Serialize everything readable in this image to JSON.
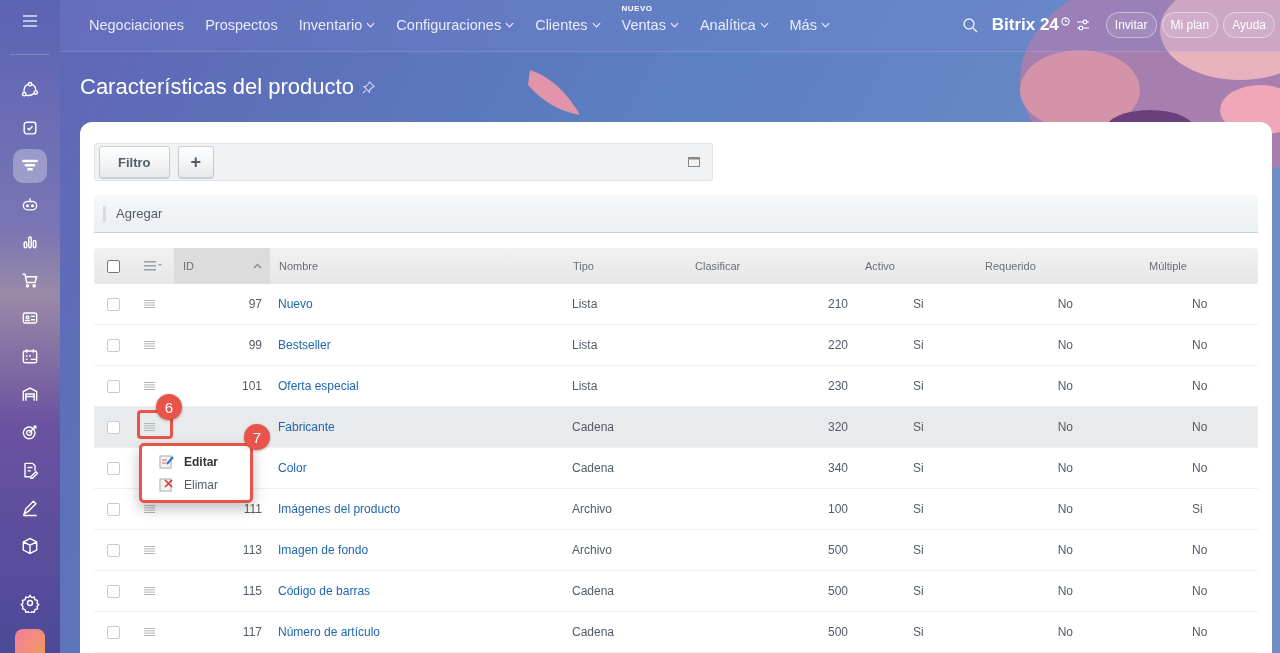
{
  "sidebar": {
    "items": [
      {
        "selected": false
      },
      {
        "selected": false
      },
      {
        "selected": true
      },
      {
        "selected": false
      },
      {
        "selected": false
      },
      {
        "selected": false
      },
      {
        "selected": false
      },
      {
        "selected": false
      },
      {
        "selected": false
      },
      {
        "selected": false
      },
      {
        "selected": false
      },
      {
        "selected": false
      },
      {
        "selected": false
      }
    ]
  },
  "nav": {
    "items": [
      {
        "label": "Negociaciones",
        "dropdown": false
      },
      {
        "label": "Prospectos",
        "dropdown": false
      },
      {
        "label": "Inventario",
        "dropdown": true
      },
      {
        "label": "Configuraciones",
        "dropdown": true
      },
      {
        "label": "Clientes",
        "dropdown": true
      },
      {
        "label": "Ventas",
        "dropdown": true,
        "badge": "NUEVO"
      },
      {
        "label": "Analítica",
        "dropdown": true
      },
      {
        "label": "Más",
        "dropdown": true
      }
    ],
    "logo": "Bitrix 24",
    "buttons": [
      "Invitar",
      "Mi plan",
      "Ayuda"
    ]
  },
  "page": {
    "title": "Características del producto"
  },
  "toolbar": {
    "filter": "Filtro",
    "add": "+",
    "action_bar": "Agregar"
  },
  "table": {
    "columns": [
      {
        "label": "ID",
        "sorted": true
      },
      {
        "label": "Nombre",
        "sorted": false
      },
      {
        "label": "Tipo",
        "sorted": false
      },
      {
        "label": "Clasificar",
        "sorted": false
      },
      {
        "label": "Activo",
        "sorted": false
      },
      {
        "label": "Requerido",
        "sorted": false
      },
      {
        "label": "Múltiple",
        "sorted": false
      }
    ],
    "header_checked": false,
    "rows": [
      {
        "id": "97",
        "name": "Nuevo",
        "type": "Lista",
        "sort": "210",
        "active": "Si",
        "required": "No",
        "multiple": "No",
        "checked": false,
        "highlighted": false
      },
      {
        "id": "99",
        "name": "Bestseller",
        "type": "Lista",
        "sort": "220",
        "active": "Si",
        "required": "No",
        "multiple": "No",
        "checked": false,
        "highlighted": false
      },
      {
        "id": "101",
        "name": "Oferta especial",
        "type": "Lista",
        "sort": "230",
        "active": "Si",
        "required": "No",
        "multiple": "No",
        "checked": false,
        "highlighted": false
      },
      {
        "name": "Fabricante",
        "type": "Cadena",
        "sort": "320",
        "active": "Si",
        "required": "No",
        "multiple": "No",
        "checked": false,
        "highlighted": true,
        "menu_open": true
      },
      {
        "name": "Color",
        "type": "Cadena",
        "sort": "340",
        "active": "Si",
        "required": "No",
        "multiple": "No",
        "checked": false,
        "highlighted": false
      },
      {
        "id": "111",
        "name": "Imágenes del producto",
        "type": "Archivo",
        "sort": "100",
        "active": "Si",
        "required": "No",
        "multiple": "Si",
        "checked": false,
        "highlighted": false
      },
      {
        "id": "113",
        "name": "Imagen de fondo",
        "type": "Archivo",
        "sort": "500",
        "active": "Si",
        "required": "No",
        "multiple": "No",
        "checked": false,
        "highlighted": false
      },
      {
        "id": "115",
        "name": "Código de barras",
        "type": "Cadena",
        "sort": "500",
        "active": "Si",
        "required": "No",
        "multiple": "No",
        "checked": false,
        "highlighted": false
      },
      {
        "id": "117",
        "name": "Número de artículo",
        "type": "Cadena",
        "sort": "500",
        "active": "Si",
        "required": "No",
        "multiple": "No",
        "checked": false,
        "highlighted": false
      }
    ]
  },
  "context_menu": {
    "items": [
      {
        "label": "Editar",
        "kind": "edit",
        "hovered": true
      },
      {
        "label": "Elimar",
        "kind": "delete",
        "hovered": false
      }
    ]
  },
  "callouts": [
    "6",
    "7"
  ]
}
